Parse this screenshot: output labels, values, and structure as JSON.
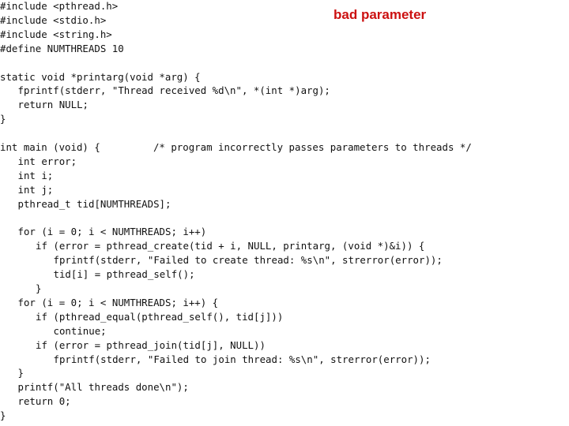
{
  "title": "bad parameter",
  "title_color": "#cc1111",
  "code_lines": [
    {
      "indent": 0,
      "text": "#include <pthread.h>"
    },
    {
      "indent": 0,
      "text": "#include <stdio.h>"
    },
    {
      "indent": 0,
      "text": "#include <string.h>"
    },
    {
      "indent": 0,
      "text": "#define NUMTHREADS 10"
    },
    {
      "indent": 0,
      "text": ""
    },
    {
      "indent": 0,
      "text": "static void *printarg(void *arg) {"
    },
    {
      "indent": 1,
      "text": "fprintf(stderr, \"Thread received %d\\n\", *(int *)arg);"
    },
    {
      "indent": 1,
      "text": "return NULL;"
    },
    {
      "indent": 0,
      "text": "}"
    },
    {
      "indent": 0,
      "text": ""
    },
    {
      "indent": 0,
      "text": "int main (void) {         /* program incorrectly passes parameters to threads */"
    },
    {
      "indent": 1,
      "text": "int error;"
    },
    {
      "indent": 1,
      "text": "int i;"
    },
    {
      "indent": 1,
      "text": "int j;"
    },
    {
      "indent": 1,
      "text": "pthread_t tid[NUMTHREADS];"
    },
    {
      "indent": 0,
      "text": ""
    },
    {
      "indent": 1,
      "text": "for (i = 0; i < NUMTHREADS; i++)"
    },
    {
      "indent": 2,
      "text": "if (error = pthread_create(tid + i, NULL, printarg, (void *)&i)) {"
    },
    {
      "indent": 3,
      "text": "fprintf(stderr, \"Failed to create thread: %s\\n\", strerror(error));"
    },
    {
      "indent": 3,
      "text": "tid[i] = pthread_self();"
    },
    {
      "indent": 2,
      "text": "}"
    },
    {
      "indent": 1,
      "text": "for (i = 0; i < NUMTHREADS; i++) {"
    },
    {
      "indent": 2,
      "text": "if (pthread_equal(pthread_self(), tid[j]))"
    },
    {
      "indent": 3,
      "text": "continue;"
    },
    {
      "indent": 2,
      "text": "if (error = pthread_join(tid[j], NULL))"
    },
    {
      "indent": 3,
      "text": "fprintf(stderr, \"Failed to join thread: %s\\n\", strerror(error));"
    },
    {
      "indent": 1,
      "text": "}"
    },
    {
      "indent": 1,
      "text": "printf(\"All threads done\\n\");"
    },
    {
      "indent": 1,
      "text": "return 0;"
    },
    {
      "indent": 0,
      "text": "}"
    }
  ]
}
